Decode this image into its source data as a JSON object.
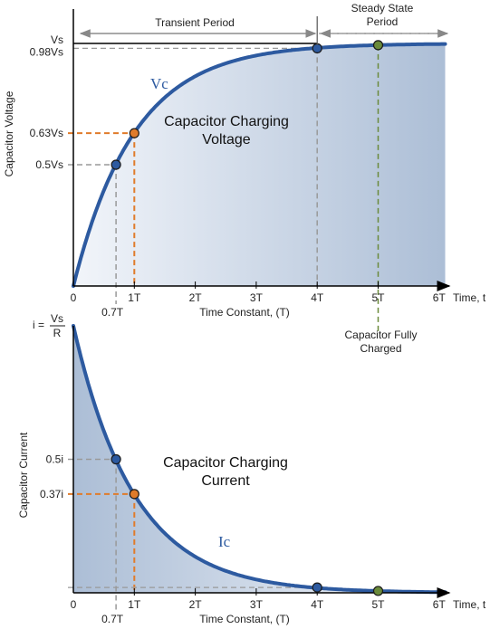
{
  "chart_data": [
    {
      "type": "line",
      "title": "Capacitor Charging Voltage",
      "title_lines": [
        "Capacitor Charging",
        "Voltage"
      ],
      "curve_label": "Vc",
      "ylabel": "Capacitor Voltage",
      "xlabel": "Time Constant, (T)",
      "x_axis_end_label": "Time, t",
      "function": "Vs*(1-exp(-t/T))",
      "xlim": [
        0,
        6.3
      ],
      "ylim": [
        0,
        1.0
      ],
      "x_ticks": [
        {
          "value": 0,
          "label": "0"
        },
        {
          "value": 1,
          "label": "1T",
          "color": "#e07b2a"
        },
        {
          "value": 2,
          "label": "2T"
        },
        {
          "value": 3,
          "label": "3T"
        },
        {
          "value": 4,
          "label": "4T"
        },
        {
          "value": 5,
          "label": "5T",
          "color": "#6a8a3a"
        },
        {
          "value": 6,
          "label": "6T"
        }
      ],
      "extra_x_label": {
        "value": 0.7,
        "label": "0.7T"
      },
      "y_labels": [
        {
          "value": 1.0,
          "label": "Vs"
        },
        {
          "value": 0.98,
          "label": "0.98Vs"
        },
        {
          "value": 0.63,
          "label": "0.63Vs",
          "color": "#e07b2a"
        },
        {
          "value": 0.5,
          "label": "0.5Vs"
        }
      ],
      "points": [
        {
          "t": 0.7,
          "v": 0.5,
          "color": "#2d5aa0"
        },
        {
          "t": 1.0,
          "v": 0.63,
          "color": "#e07b2a"
        },
        {
          "t": 4.0,
          "v": 0.98,
          "color": "#2d5aa0"
        },
        {
          "t": 5.0,
          "v": 0.993,
          "color": "#6a8a3a"
        }
      ],
      "periods": [
        {
          "label": "Transient Period",
          "from": 0,
          "to": 4
        },
        {
          "label": "Steady State Period",
          "lines": [
            "Steady State",
            "Period"
          ],
          "from": 4,
          "to": 6.2
        }
      ],
      "annotation": {
        "lines": [
          "Capacitor Fully",
          "Charged"
        ],
        "t": 5
      }
    },
    {
      "type": "line",
      "title": "Capacitor Charging Current",
      "title_lines": [
        "Capacitor Charging",
        "Current"
      ],
      "curve_label": "Ic",
      "ylabel": "Capacitor Current",
      "xlabel": "Time Constant, (T)",
      "x_axis_end_label": "Time, t",
      "function": "i*exp(-t/T)",
      "initial_label": {
        "prefix": "i =",
        "numerator": "Vs",
        "denominator": "R"
      },
      "xlim": [
        0,
        6.3
      ],
      "ylim": [
        0,
        1.0
      ],
      "x_ticks": [
        {
          "value": 0,
          "label": "0"
        },
        {
          "value": 1,
          "label": "1T",
          "color": "#e07b2a"
        },
        {
          "value": 2,
          "label": "2T"
        },
        {
          "value": 3,
          "label": "3T"
        },
        {
          "value": 4,
          "label": "4T"
        },
        {
          "value": 5,
          "label": "5T",
          "color": "#6a8a3a"
        },
        {
          "value": 6,
          "label": "6T"
        }
      ],
      "extra_x_label": {
        "value": 0.7,
        "label": "0.7T"
      },
      "y_labels": [
        {
          "value": 0.5,
          "label": "0.5i"
        },
        {
          "value": 0.37,
          "label": "0.37i",
          "color": "#e07b2a"
        }
      ],
      "points": [
        {
          "t": 0.7,
          "v": 0.5,
          "color": "#2d5aa0"
        },
        {
          "t": 1.0,
          "v": 0.37,
          "color": "#e07b2a"
        },
        {
          "t": 4.0,
          "v": 0.02,
          "color": "#2d5aa0"
        },
        {
          "t": 5.0,
          "v": 0.007,
          "color": "#6a8a3a"
        }
      ]
    }
  ],
  "colors": {
    "curve": "#2d5aa0",
    "orange": "#e07b2a",
    "green": "#6a8a3a",
    "fill_light": "#eef2f8",
    "fill_dark": "#aebfd6"
  }
}
